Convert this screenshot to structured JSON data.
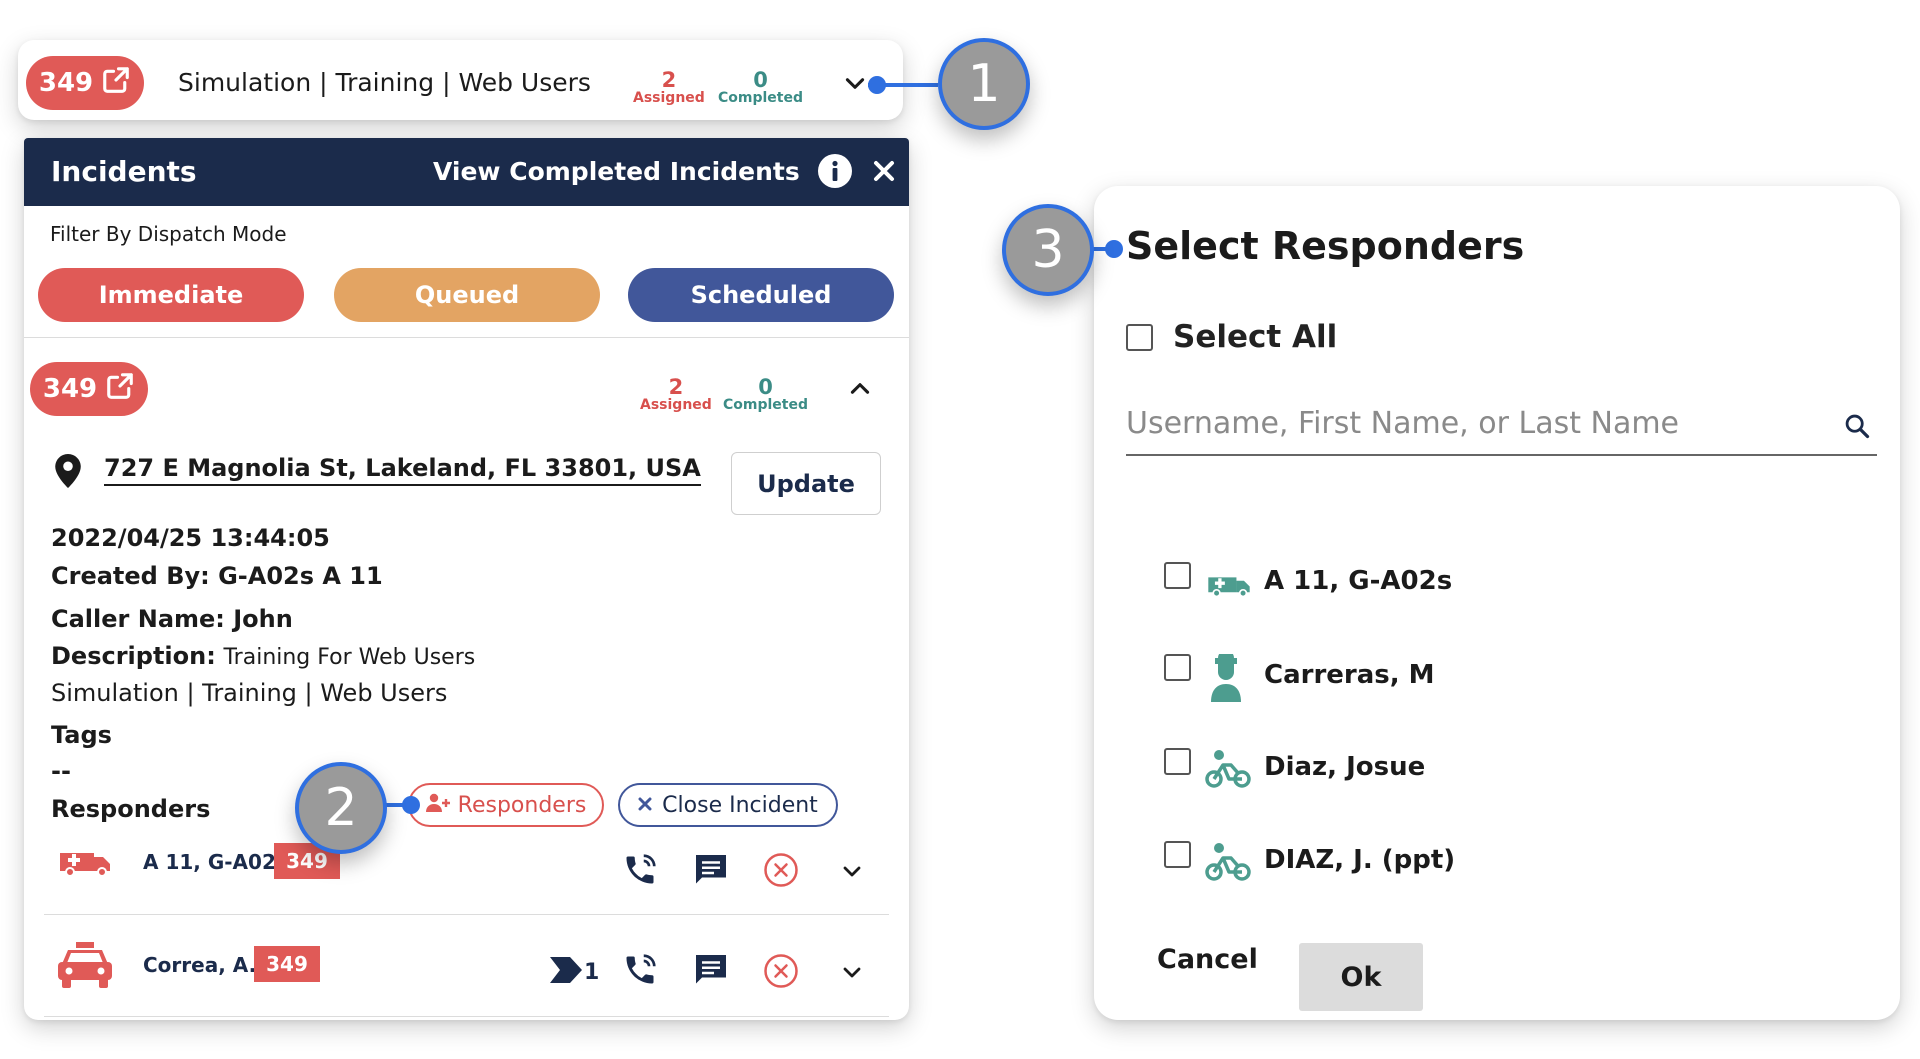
{
  "topbar": {
    "incident_number": "349",
    "title": "Simulation | Training | Web Users",
    "assigned_count": "2",
    "assigned_label": "Assigned",
    "completed_count": "0",
    "completed_label": "Completed"
  },
  "panel": {
    "title": "Incidents",
    "view_completed": "View Completed Incidents",
    "filter_label": "Filter By Dispatch Mode",
    "modes": {
      "immediate": "Immediate",
      "queued": "Queued",
      "scheduled": "Scheduled"
    },
    "incident": {
      "number": "349",
      "assigned_count": "2",
      "assigned_label": "Assigned",
      "completed_count": "0",
      "completed_label": "Completed",
      "address": "727 E Magnolia St, Lakeland, FL 33801, USA",
      "update_label": "Update",
      "datetime": "2022/04/25 13:44:05",
      "created_by": "Created By: G-A02s A 11",
      "caller_name": "Caller Name: John",
      "description_label": "Description:",
      "description_value": "Training For Web Users",
      "category": "Simulation | Training | Web Users",
      "tags_label": "Tags",
      "tags_value": "--",
      "responders_label": "Responders",
      "responders_button": "Responders",
      "close_button": "Close Incident",
      "responders": [
        {
          "name": "A 11, G-A02s",
          "badge": "349",
          "icon": "ambulance-icon"
        },
        {
          "name": "Correa, A.",
          "badge": "349",
          "icon": "car-icon",
          "queue_count": "1"
        }
      ]
    }
  },
  "dialog": {
    "title": "Select Responders",
    "select_all": "Select All",
    "search_placeholder": "Username, First Name, or Last Name",
    "responders": [
      {
        "name": "A 11, G-A02s",
        "icon": "ambulance-icon"
      },
      {
        "name": "Carreras, M",
        "icon": "person-icon"
      },
      {
        "name": "Diaz, Josue",
        "icon": "bicycle-icon"
      },
      {
        "name": "DIAZ, J. (ppt)",
        "icon": "bicycle-icon"
      }
    ],
    "cancel_label": "Cancel",
    "ok_label": "Ok"
  },
  "callouts": [
    "1",
    "2",
    "3"
  ],
  "colors": {
    "navy": "#1b2b4b",
    "immediate": "#e05a57",
    "queued": "#e3a463",
    "scheduled": "#41579a",
    "assigned": "#d8504d",
    "completed": "#3b8c86",
    "responder_icon": "#4d9d8f",
    "callout_accent": "#2f6fe0"
  }
}
